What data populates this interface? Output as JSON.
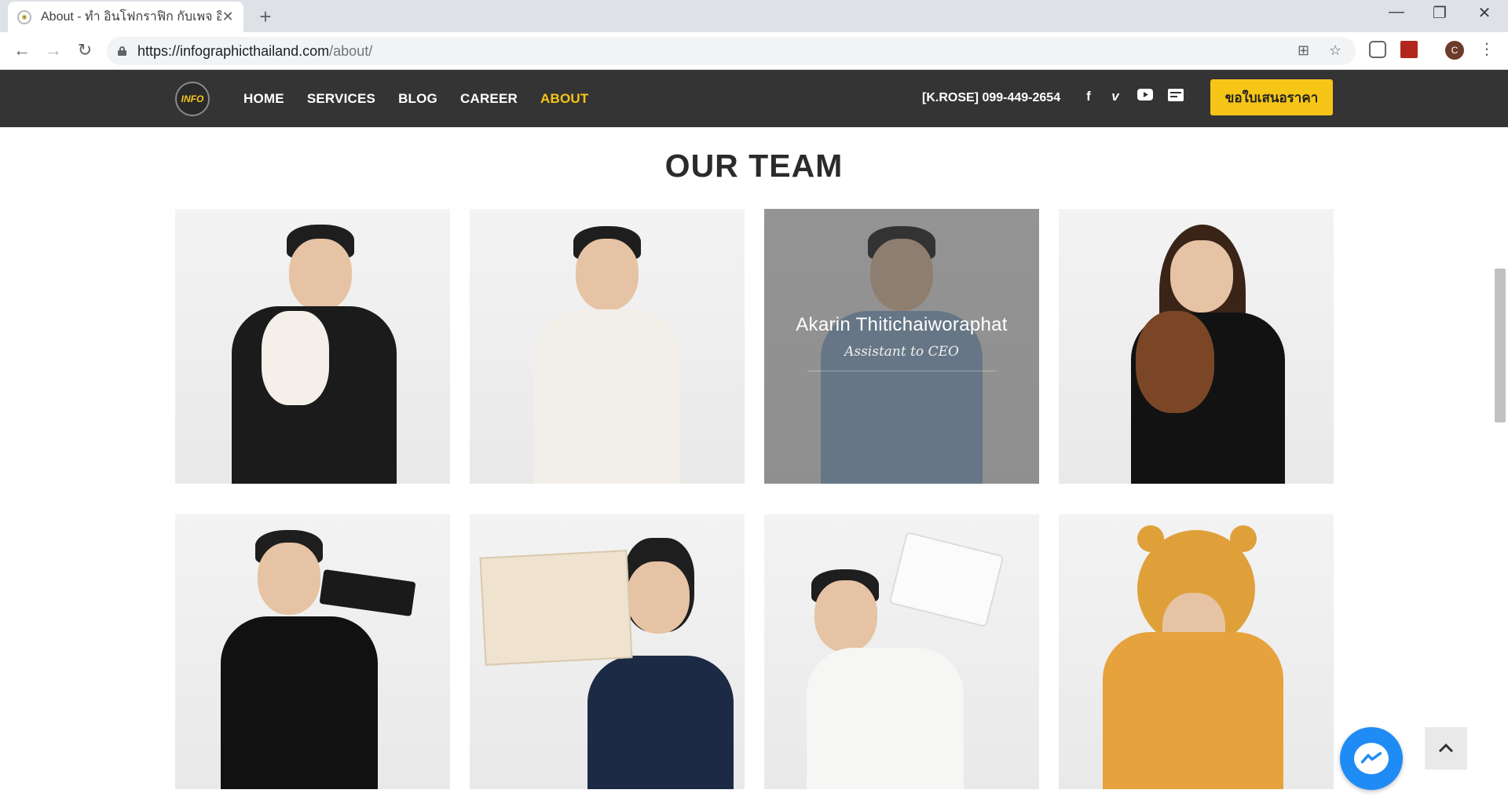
{
  "browser": {
    "tab_title": "About - ทำ อินโฟกราฟิก กับเพจ อินโฟ",
    "url_host": "https://infographicthailand.com",
    "url_path": "/about/"
  },
  "site": {
    "logo_text": "INFO",
    "menu": [
      {
        "label": "HOME",
        "active": false
      },
      {
        "label": "SERVICES",
        "active": false
      },
      {
        "label": "BLOG",
        "active": false
      },
      {
        "label": "CAREER",
        "active": false
      },
      {
        "label": "ABOUT",
        "active": true
      }
    ],
    "phone": "[K.ROSE] 099-449-2654",
    "social_icons": [
      "facebook-icon",
      "vimeo-icon",
      "youtube-icon",
      "blogger-icon"
    ],
    "quote_button": "ขอใบเสนอราคา",
    "accent_color": "#f5c518"
  },
  "section": {
    "title": "OUR TEAM"
  },
  "team": {
    "highlighted": {
      "name": "Akarin Thitichaiworaphat",
      "role": "Assistant to CEO"
    }
  }
}
